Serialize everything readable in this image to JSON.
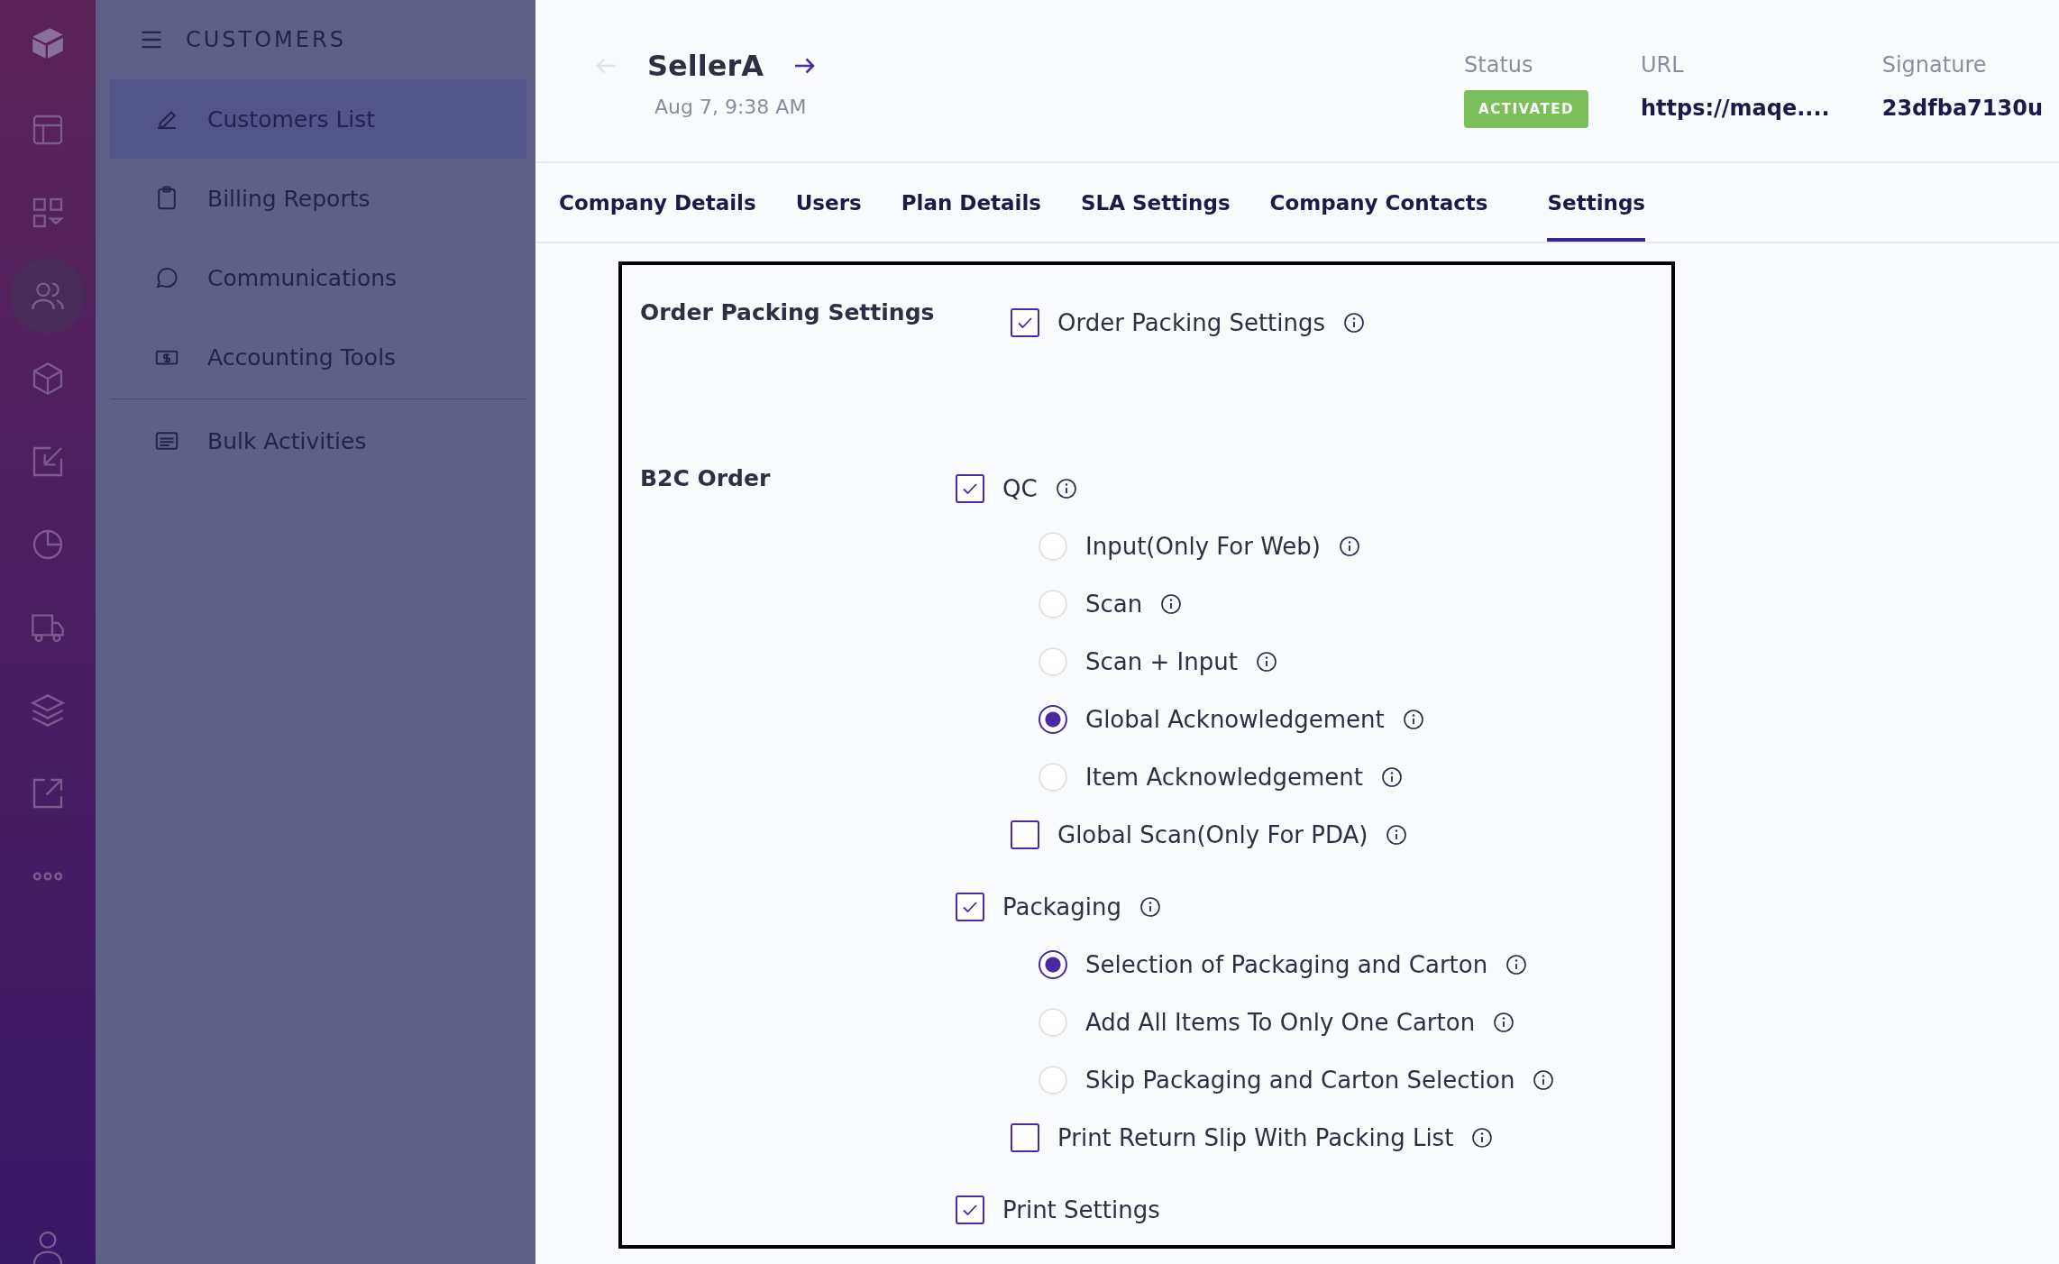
{
  "sidebar": {
    "title": "CUSTOMERS",
    "items": [
      {
        "label": "Customers List",
        "selected": true
      },
      {
        "label": "Billing Reports",
        "selected": false
      },
      {
        "label": "Communications",
        "selected": false
      },
      {
        "label": "Accounting Tools",
        "selected": false
      },
      {
        "label": "Bulk Activities",
        "selected": false
      }
    ]
  },
  "header": {
    "title": "SellerA",
    "back_disabled": true,
    "date": "Aug 7, 9:38 AM",
    "fields": [
      {
        "label": "Status",
        "value": "ACTIVATED",
        "kind": "badge"
      },
      {
        "label": "URL",
        "value": "https://maqe....",
        "kind": "text"
      },
      {
        "label": "Signature",
        "value": "23dfba7130u",
        "kind": "text"
      }
    ]
  },
  "tabs": [
    {
      "label": "Company Details",
      "selected": false
    },
    {
      "label": "Users",
      "selected": false
    },
    {
      "label": "Plan Details",
      "selected": false
    },
    {
      "label": "SLA Settings",
      "selected": false
    },
    {
      "label": "Company Contacts",
      "selected": false
    },
    {
      "label": "Settings",
      "selected": true
    }
  ],
  "sections": [
    {
      "title": "Order Packing Settings",
      "items": [
        {
          "kind": "checkbox",
          "label": "Order Packing Settings",
          "checked": true
        }
      ]
    },
    {
      "title": "B2C Order",
      "items": [
        {
          "kind": "checkbox",
          "label": "QC",
          "checked": true,
          "children": [
            {
              "kind": "radio",
              "label": "Input(Only For Web)",
              "selected": false
            },
            {
              "kind": "radio",
              "label": "Scan",
              "selected": false
            },
            {
              "kind": "radio",
              "label": "Scan + Input",
              "selected": false
            },
            {
              "kind": "radio",
              "label": "Global Acknowledgement",
              "selected": true
            },
            {
              "kind": "radio",
              "label": "Item Acknowledgement",
              "selected": false
            },
            {
              "kind": "checkbox",
              "label": "Global Scan(Only For PDA)",
              "checked": false
            }
          ]
        },
        {
          "kind": "checkbox",
          "label": "Packaging",
          "checked": true,
          "children": [
            {
              "kind": "radio",
              "label": "Selection of Packaging and Carton",
              "selected": true
            },
            {
              "kind": "radio",
              "label": "Add All Items To Only One Carton",
              "selected": false
            },
            {
              "kind": "radio",
              "label": "Skip Packaging and Carton Selection",
              "selected": false
            },
            {
              "kind": "checkbox",
              "label": "Print Return Slip With Packing List",
              "checked": false
            }
          ]
        },
        {
          "kind": "checkbox",
          "label": "Print Settings",
          "checked": true,
          "info": false
        }
      ]
    }
  ]
}
